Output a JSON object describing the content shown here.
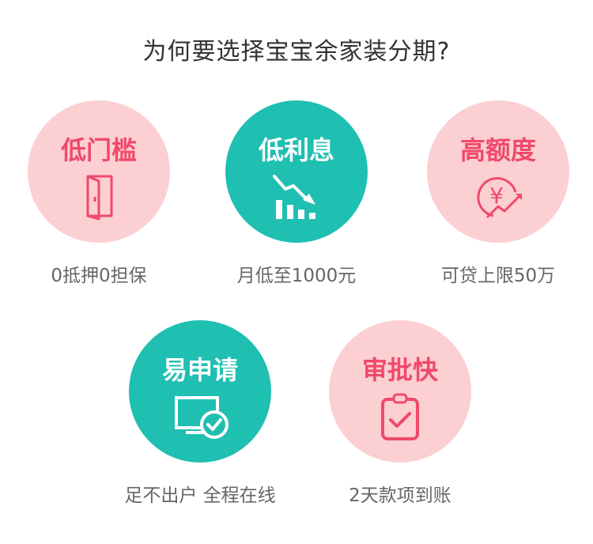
{
  "page": {
    "title": "为何要选择宝宝余家装分期?"
  },
  "features": [
    {
      "title": "低门槛",
      "caption": "0抵押0担保",
      "icon": "door-icon",
      "style": "pink"
    },
    {
      "title": "低利息",
      "caption": "月低至1000元",
      "icon": "declining-chart-icon",
      "style": "teal"
    },
    {
      "title": "高额度",
      "caption": "可贷上限50万",
      "icon": "yen-growth-icon",
      "style": "pink"
    },
    {
      "title": "易申请",
      "caption": "足不出户  全程在线",
      "icon": "monitor-check-icon",
      "style": "teal"
    },
    {
      "title": "审批快",
      "caption": "2天款项到账",
      "icon": "clipboard-check-icon",
      "style": "pink"
    }
  ],
  "colors": {
    "pink_bg": "#fccfd2",
    "pink_text": "#ef4a6b",
    "teal_bg": "#1fbfb2",
    "caption": "#666666",
    "title": "#333333"
  },
  "icon_text": {
    "yen": "¥"
  }
}
